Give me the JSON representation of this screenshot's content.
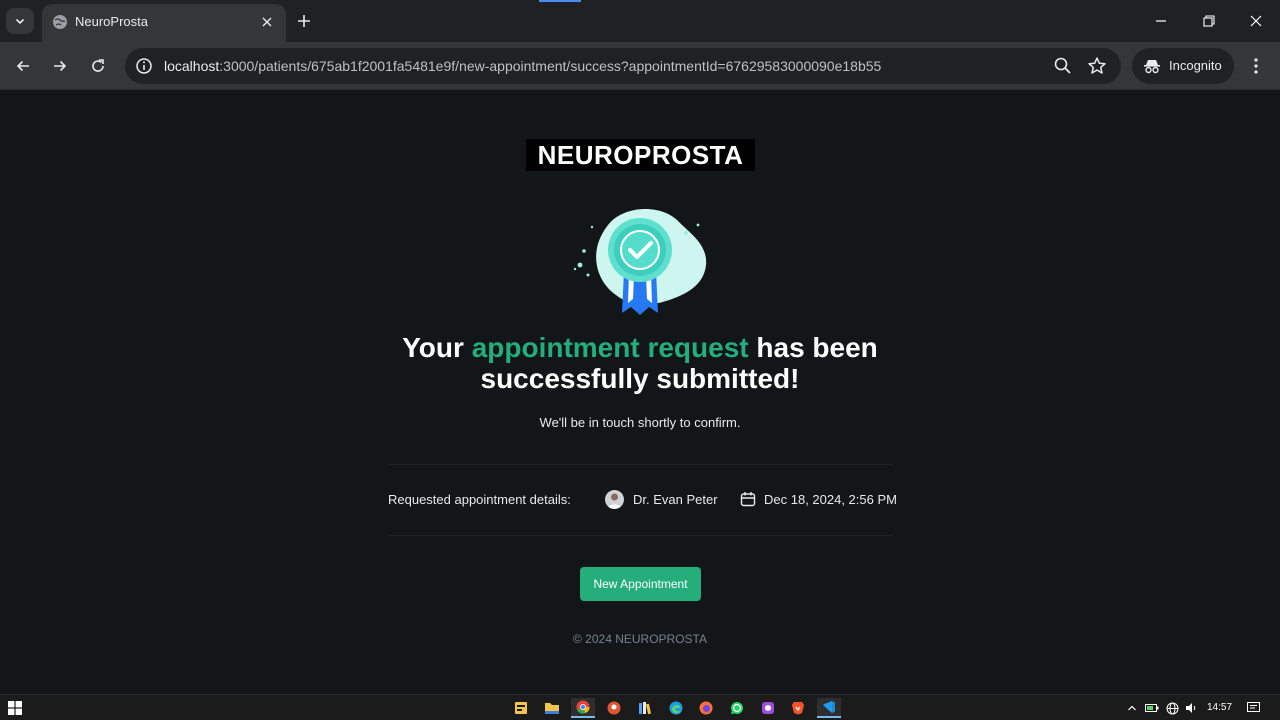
{
  "browser": {
    "tab": {
      "title": "NeuroProsta"
    },
    "url": {
      "host": "localhost",
      "rest": ":3000/patients/675ab1f2001fa5481e9f/new-appointment/success?appointmentId=67629583000090e18b55"
    },
    "incognito_label": "Incognito"
  },
  "page": {
    "logo_text": "NEUROPROSTA",
    "headline": {
      "part1": "Your ",
      "accent": "appointment request",
      "part2": " has been successfully submitted!"
    },
    "subtext": "We'll be in touch shortly to confirm.",
    "details": {
      "label": "Requested appointment details:",
      "doctor": "Dr. Evan Peter",
      "date": "Dec 18, 2024, 2:56 PM"
    },
    "new_appointment_label": "New Appointment",
    "copyright": "© 2024 NEUROPROSTA",
    "colors": {
      "accent": "#24ae7c",
      "background": "#131619"
    }
  },
  "taskbar": {
    "clock": "14:57",
    "apps": [
      "windows-icon",
      "explorer-icon",
      "file-manager-icon",
      "chrome-icon",
      "duckduckgo-icon",
      "library-icon",
      "edge-icon",
      "firefox-icon",
      "whatsapp-icon",
      "obs-icon",
      "brave-icon",
      "vscode-icon"
    ]
  }
}
